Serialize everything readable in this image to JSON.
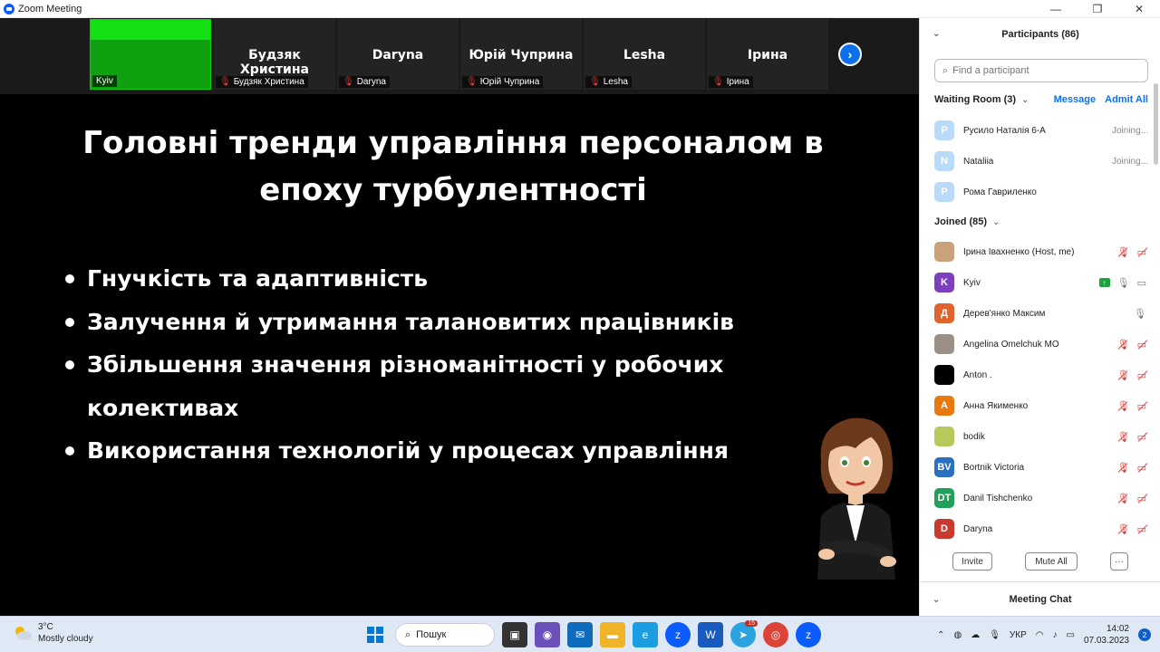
{
  "window": {
    "title": "Zoom Meeting",
    "controls": {
      "minimize": "—",
      "maximize": "❐",
      "close": "✕"
    }
  },
  "video_strip": {
    "tiles": [
      {
        "name": "",
        "tag": "Kyiv",
        "muted": false,
        "video_on": true
      },
      {
        "name": "Будзяк Христина",
        "tag": "Будзяк Христина",
        "muted": true
      },
      {
        "name": "Daryna",
        "tag": "Daryna",
        "muted": true
      },
      {
        "name": "Юрій Чуприна",
        "tag": "Юрій Чуприна",
        "muted": true
      },
      {
        "name": "Lesha",
        "tag": "Lesha",
        "muted": true
      },
      {
        "name": "Ірина",
        "tag": "Ірина",
        "muted": true
      }
    ],
    "next_icon": "chevron-right-icon"
  },
  "slide": {
    "title_line1": "Головні тренди управління персоналом в",
    "title_line2": "епоху турбулентності",
    "bullets": [
      "Гнучкість та адаптивність",
      "Залучення й утримання талановитих працівників",
      "Збільшення значення різноманітності  у робочих колективах",
      "Використання технологій у процесах управління"
    ]
  },
  "panel": {
    "title": "Participants (86)",
    "search_placeholder": "Find a participant",
    "waiting_room": {
      "label": "Waiting Room (3)",
      "message": "Message",
      "admit_all": "Admit All",
      "items": [
        {
          "initial": "Р",
          "name": "Русило Наталія 6-А",
          "status": "Joining...",
          "color": "#b9daf8"
        },
        {
          "initial": "N",
          "name": "Nataliia",
          "status": "Joining...",
          "color": "#b9daf8"
        },
        {
          "initial": "Р",
          "name": "Рома Гавриленко",
          "status": "",
          "color": "#b9daf8"
        }
      ]
    },
    "joined": {
      "label": "Joined (85)",
      "items": [
        {
          "initial": "",
          "name": "Ірина Івахненко (Host, me)",
          "color": "#c9a27a",
          "mic": "muted",
          "video": "off"
        },
        {
          "initial": "K",
          "name": "Kyiv",
          "color": "#7e3fbf",
          "mic": "on",
          "video": "on",
          "sharing": true
        },
        {
          "initial": "Д",
          "name": "Дерев'янко Максим",
          "color": "#e0632b",
          "mic": "on",
          "video": "none"
        },
        {
          "initial": "",
          "name": "Angelina Omelchuk МО",
          "color": "#9b8f86",
          "mic": "muted",
          "video": "off"
        },
        {
          "initial": "",
          "name": "Anton .",
          "color": "#000000",
          "mic": "muted",
          "video": "off"
        },
        {
          "initial": "А",
          "name": "Анна Якименко",
          "color": "#e8790f",
          "mic": "muted",
          "video": "off"
        },
        {
          "initial": "",
          "name": "bodik",
          "color": "#b7c95a",
          "mic": "muted",
          "video": "off"
        },
        {
          "initial": "BV",
          "name": "Bortnik Victoria",
          "color": "#2a6fc0",
          "mic": "muted",
          "video": "off"
        },
        {
          "initial": "DT",
          "name": "Danil Tishchenko",
          "color": "#22a05a",
          "mic": "muted",
          "video": "off"
        },
        {
          "initial": "D",
          "name": "Daryna",
          "color": "#c93a2e",
          "mic": "muted",
          "video": "off"
        }
      ]
    },
    "buttons": {
      "invite": "Invite",
      "mute_all": "Mute All",
      "more": "···"
    },
    "chat_title": "Meeting Chat"
  },
  "taskbar": {
    "weather_temp": "3°C",
    "weather_desc": "Mostly cloudy",
    "search_label": "Пошук",
    "telegram_badge": "15",
    "language": "УКР",
    "time": "14:02",
    "date": "07.03.2023",
    "notifications": "2"
  },
  "colors": {
    "accent": "#0e71eb",
    "muted": "#e23b3b",
    "green_tile": "#0fa10f"
  }
}
